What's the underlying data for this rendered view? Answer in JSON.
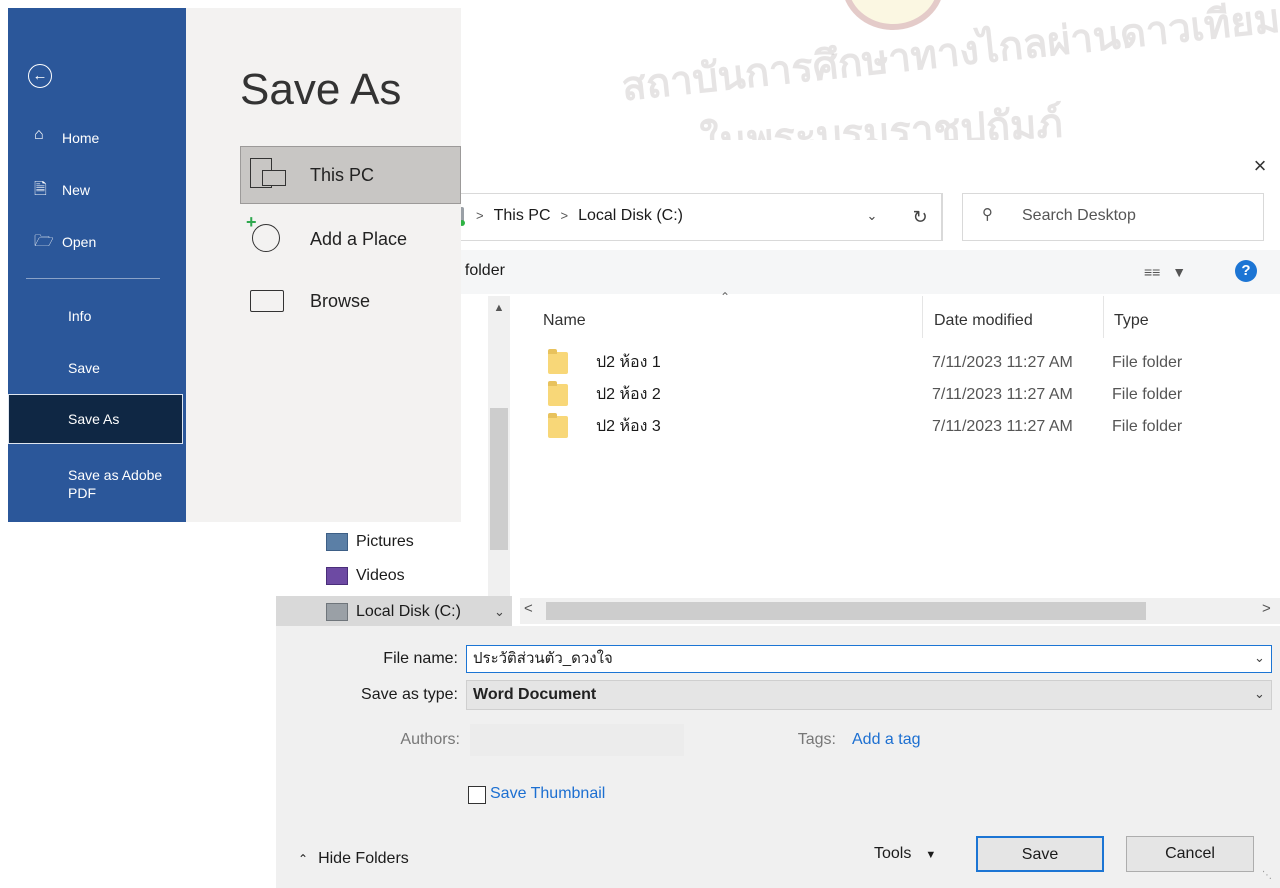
{
  "watermark": {
    "line1": "สถาบันการศึกษาทางไกลผ่านดาวเทียม",
    "line2": "ในพระบรมราชูปถัมภ์"
  },
  "backstage": {
    "back_icon": "back-arrow-icon",
    "nav": [
      {
        "label": "Home",
        "icon": "home-icon"
      },
      {
        "label": "New",
        "icon": "new-document-icon"
      },
      {
        "label": "Open",
        "icon": "open-folder-icon"
      },
      {
        "label": "Info"
      },
      {
        "label": "Save"
      },
      {
        "label": "Save As",
        "selected": true
      },
      {
        "label": "Save as Adobe PDF"
      }
    ],
    "title": "Save As",
    "locations": [
      {
        "label": "This PC",
        "icon": "computer-icon",
        "selected": true
      },
      {
        "label": "Add a Place",
        "icon": "add-place-icon"
      },
      {
        "label": "Browse",
        "icon": "folder-icon"
      }
    ],
    "accent": "#2b579a"
  },
  "dialog": {
    "close": "×",
    "breadcrumb": [
      "This PC",
      "Local Disk (C:)"
    ],
    "search_placeholder": "Search Desktop",
    "new_folder": "ew folder",
    "help": "?",
    "nav_items": [
      "Pictures",
      "Videos",
      "Local Disk (C:)"
    ],
    "columns": [
      "Name",
      "Date modified",
      "Type"
    ],
    "rows": [
      {
        "name": "ป2 ห้อง 1",
        "date": "7/11/2023 11:27 AM",
        "type": "File folder"
      },
      {
        "name": "ป2 ห้อง 2",
        "date": "7/11/2023 11:27 AM",
        "type": "File folder"
      },
      {
        "name": "ป2 ห้อง 3",
        "date": "7/11/2023 11:27 AM",
        "type": "File folder"
      }
    ],
    "file_name_label": "File name:",
    "file_name_value": "ประวัติส่วนตัว_ดวงใจ",
    "save_type_label": "Save as type:",
    "save_type_value": "Word Document",
    "authors_label": "Authors:",
    "tags_label": "Tags:",
    "tags_link": "Add a tag",
    "thumbnail_label": "Save Thumbnail",
    "hide_folders": "Hide Folders",
    "tools": "Tools",
    "save": "Save",
    "cancel": "Cancel",
    "accent": "#1c75d4"
  }
}
